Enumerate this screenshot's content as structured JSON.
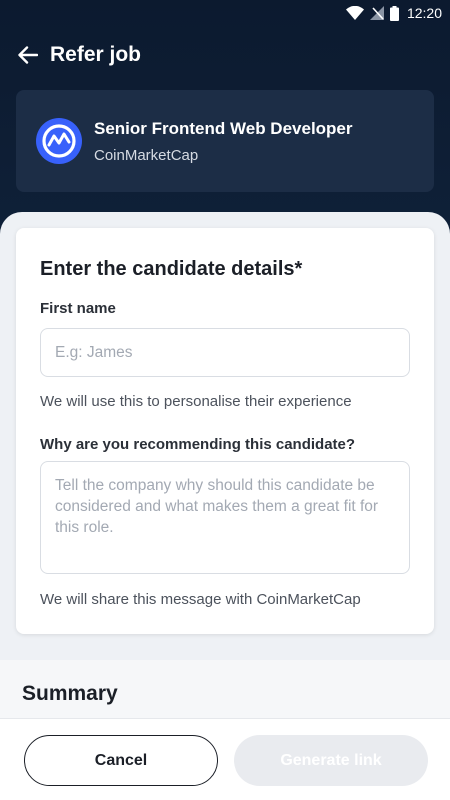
{
  "status_bar": {
    "time": "12:20",
    "icons": [
      "wifi-icon",
      "no-signal-icon",
      "battery-icon"
    ]
  },
  "app_bar": {
    "back_icon": "arrow-left-icon",
    "title": "Refer job"
  },
  "job": {
    "title": "Senior Frontend Web Developer",
    "company": "CoinMarketCap",
    "logo_icon": "coinmarketcap-logo",
    "logo_color": "#3861fb"
  },
  "form": {
    "heading": "Enter the candidate details*",
    "first_name": {
      "label": "First name",
      "placeholder": "E.g: James",
      "value": "",
      "helper": "We will use this to personalise their experience"
    },
    "reason": {
      "label": "Why are you recommending this candidate?",
      "placeholder": "Tell the company why should this candidate be considered and what makes them a great fit for this role.",
      "value": "",
      "helper": "We will share this message with CoinMarketCap"
    }
  },
  "summary": {
    "title": "Summary"
  },
  "actions": {
    "cancel_label": "Cancel",
    "generate_label": "Generate link",
    "generate_enabled": false
  },
  "colors": {
    "header_bg": "#0c1a2f",
    "card_bg": "#1c2d46",
    "accent": "#3861fb",
    "disabled_button": "#e9ebef"
  }
}
